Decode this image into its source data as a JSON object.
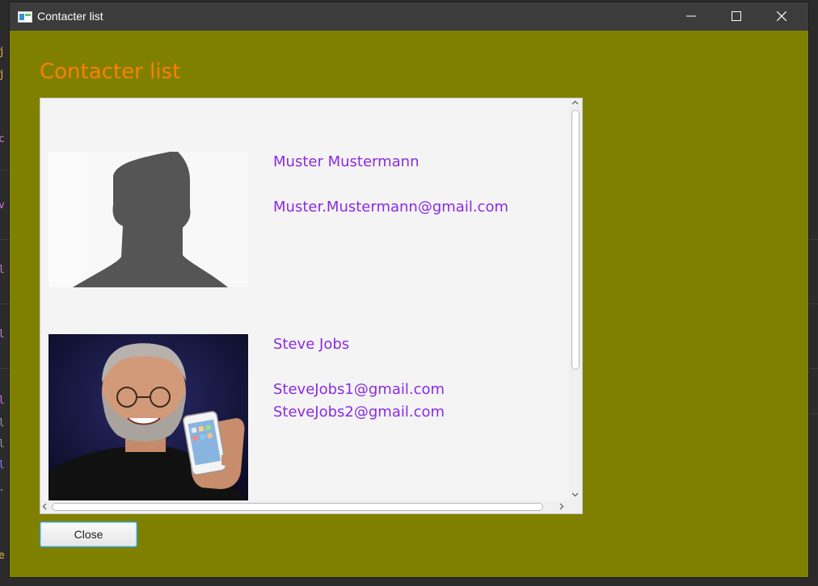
{
  "window": {
    "title": "Contacter list",
    "icon": "app-window-icon"
  },
  "page": {
    "heading": "Contacter list"
  },
  "contacts": [
    {
      "name": "Muster Mustermann",
      "emails": [
        "Muster.Mustermann@gmail.com"
      ],
      "photo": "silhouette-placeholder"
    },
    {
      "name": "Steve Jobs",
      "emails": [
        "SteveJobs1@gmail.com",
        "SteveJobs2@gmail.com"
      ],
      "photo": "person-holding-phone"
    }
  ],
  "buttons": {
    "close_label": "Close"
  },
  "colors": {
    "window_bg": "#808000",
    "heading": "#ff8000",
    "contact_text": "#8a2be2",
    "titlebar": "#3c3c3c"
  }
}
